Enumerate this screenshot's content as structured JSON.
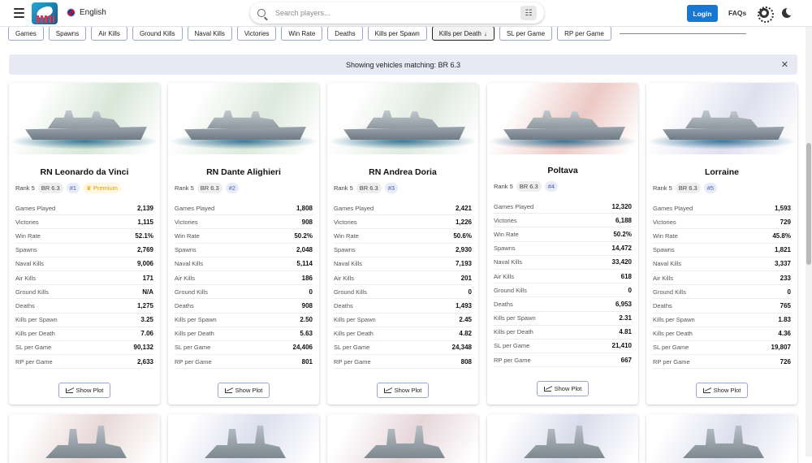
{
  "header": {
    "language": "English",
    "search_placeholder": "Search players...",
    "login_label": "Login",
    "faqs_label": "FAQs"
  },
  "chips": [
    {
      "label": "Games",
      "active": false
    },
    {
      "label": "Spawns",
      "active": false
    },
    {
      "label": "Air Kills",
      "active": false
    },
    {
      "label": "Ground Kills",
      "active": false
    },
    {
      "label": "Naval Kills",
      "active": false
    },
    {
      "label": "Victories",
      "active": false
    },
    {
      "label": "Win Rate",
      "active": false
    },
    {
      "label": "Deaths",
      "active": false
    },
    {
      "label": "Kills per Spawn",
      "active": false
    },
    {
      "label": "Kills per Death",
      "active": true,
      "sort": "↓"
    },
    {
      "label": "SL per Game",
      "active": false
    },
    {
      "label": "RP per Game",
      "active": false
    }
  ],
  "banner": {
    "text": "Showing vehicles matching: BR 6.3"
  },
  "plot_label": "Show Plot",
  "stat_labels": [
    "Games Played",
    "Victories",
    "Win Rate",
    "Spawns",
    "Naval Kills",
    "Air Kills",
    "Ground Kills",
    "Deaths",
    "Kills per Spawn",
    "Kills per Death",
    "SL per Game",
    "RP per Game"
  ],
  "vehicles": [
    {
      "name": "RN Leonardo da Vinci",
      "rank": "Rank 5",
      "br": "BR 6.3",
      "index": "#1",
      "premium": "Premium",
      "flag_color": "#d8e7d8",
      "stats": [
        "2,139",
        "1,115",
        "52.1%",
        "2,769",
        "9,006",
        "171",
        "N/A",
        "1,275",
        "3.25",
        "7.06",
        "90,132",
        "2,633"
      ]
    },
    {
      "name": "RN Dante Alighieri",
      "rank": "Rank 5",
      "br": "BR 6.3",
      "index": "#2",
      "premium": "",
      "flag_color": "#dce9dc",
      "stats": [
        "1,808",
        "908",
        "50.2%",
        "2,048",
        "5,114",
        "186",
        "0",
        "908",
        "2.50",
        "5.63",
        "24,406",
        "801"
      ]
    },
    {
      "name": "RN Andrea Doria",
      "rank": "Rank 5",
      "br": "BR 6.3",
      "index": "#3",
      "premium": "",
      "flag_color": "#dfe9df",
      "stats": [
        "2,421",
        "1,226",
        "50.6%",
        "2,930",
        "7,193",
        "201",
        "0",
        "1,493",
        "2.45",
        "4.82",
        "24,348",
        "808"
      ]
    },
    {
      "name": "Poltava",
      "rank": "Rank 5",
      "br": "BR 6.3",
      "index": "#4",
      "premium": "",
      "flag_color": "#ecc9c4",
      "stats": [
        "12,320",
        "6,188",
        "50.2%",
        "14,472",
        "33,420",
        "618",
        "0",
        "6,953",
        "2.31",
        "4.81",
        "21,410",
        "667"
      ]
    },
    {
      "name": "Lorraine",
      "rank": "Rank 5",
      "br": "BR 6.3",
      "index": "#5",
      "premium": "",
      "flag_color": "#dfdff0",
      "stats": [
        "1,593",
        "729",
        "45.8%",
        "1,821",
        "3,337",
        "233",
        "0",
        "765",
        "1.83",
        "4.36",
        "19,807",
        "726"
      ]
    }
  ],
  "next_row_flags": [
    "#e9d8d8",
    "#dcdfee",
    "#e6d6da",
    "#d9dcec",
    "#dcdfee"
  ]
}
